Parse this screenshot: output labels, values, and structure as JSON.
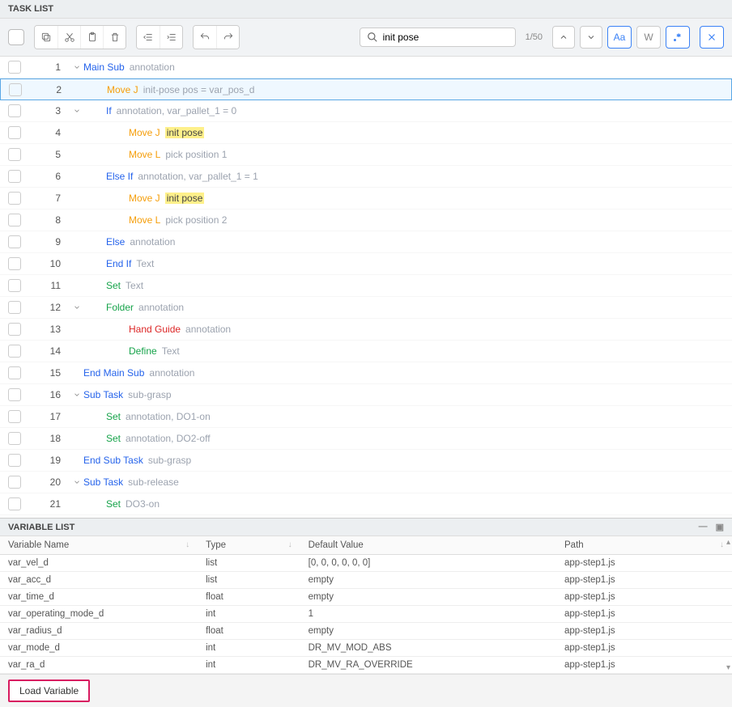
{
  "task_list": {
    "title": "TASK LIST",
    "search_value": "init pose",
    "count": "1/50",
    "toggles": {
      "aa": "Aa",
      "w": "W"
    }
  },
  "rows": [
    {
      "n": "1",
      "chev": true,
      "indent": 0,
      "parts": [
        [
          "blue",
          "Main Sub"
        ],
        [
          "anno",
          "annotation"
        ]
      ]
    },
    {
      "n": "2",
      "chev": false,
      "indent": 2,
      "selected": true,
      "parts": [
        [
          "orange",
          "Move J"
        ],
        [
          "anno",
          "init-pose  pos = var_pos_d"
        ]
      ]
    },
    {
      "n": "3",
      "chev": true,
      "indent": 2,
      "parts": [
        [
          "blue",
          "If"
        ],
        [
          "anno",
          "annotation,  var_pallet_1 = 0"
        ]
      ]
    },
    {
      "n": "4",
      "chev": false,
      "indent": 4,
      "parts": [
        [
          "orange",
          "Move J"
        ],
        [
          "hl",
          "init pose"
        ]
      ]
    },
    {
      "n": "5",
      "chev": false,
      "indent": 4,
      "parts": [
        [
          "orange",
          "Move L"
        ],
        [
          "anno",
          "pick position 1"
        ]
      ]
    },
    {
      "n": "6",
      "chev": false,
      "indent": 2,
      "parts": [
        [
          "blue",
          "Else If"
        ],
        [
          "anno",
          "annotation,  var_pallet_1 = 1"
        ]
      ]
    },
    {
      "n": "7",
      "chev": false,
      "indent": 4,
      "parts": [
        [
          "orange",
          "Move J"
        ],
        [
          "hl",
          "init pose"
        ]
      ]
    },
    {
      "n": "8",
      "chev": false,
      "indent": 4,
      "parts": [
        [
          "orange",
          "Move L"
        ],
        [
          "anno",
          "pick position 2"
        ]
      ]
    },
    {
      "n": "9",
      "chev": false,
      "indent": 2,
      "parts": [
        [
          "blue",
          "Else"
        ],
        [
          "anno",
          "annotation"
        ]
      ]
    },
    {
      "n": "10",
      "chev": false,
      "indent": 2,
      "parts": [
        [
          "blue",
          "End If"
        ],
        [
          "anno",
          "Text"
        ]
      ]
    },
    {
      "n": "11",
      "chev": false,
      "indent": 2,
      "parts": [
        [
          "green",
          "Set"
        ],
        [
          "anno",
          "Text"
        ]
      ]
    },
    {
      "n": "12",
      "chev": true,
      "indent": 2,
      "parts": [
        [
          "green",
          "Folder"
        ],
        [
          "anno",
          "annotation"
        ]
      ]
    },
    {
      "n": "13",
      "chev": false,
      "indent": 4,
      "parts": [
        [
          "red",
          "Hand Guide"
        ],
        [
          "anno",
          "annotation"
        ]
      ]
    },
    {
      "n": "14",
      "chev": false,
      "indent": 4,
      "parts": [
        [
          "green",
          "Define"
        ],
        [
          "anno",
          "Text"
        ]
      ]
    },
    {
      "n": "15",
      "chev": false,
      "indent": 0,
      "parts": [
        [
          "blue",
          "End Main Sub"
        ],
        [
          "anno",
          "annotation"
        ]
      ]
    },
    {
      "n": "16",
      "chev": true,
      "indent": 0,
      "parts": [
        [
          "blue",
          "Sub Task"
        ],
        [
          "anno",
          "sub-grasp"
        ]
      ]
    },
    {
      "n": "17",
      "chev": false,
      "indent": 2,
      "parts": [
        [
          "green",
          "Set"
        ],
        [
          "anno",
          "annotation,  DO1-on"
        ]
      ]
    },
    {
      "n": "18",
      "chev": false,
      "indent": 2,
      "parts": [
        [
          "green",
          "Set"
        ],
        [
          "anno",
          "annotation,  DO2-off"
        ]
      ]
    },
    {
      "n": "19",
      "chev": false,
      "indent": 0,
      "parts": [
        [
          "blue",
          "End Sub Task"
        ],
        [
          "anno",
          "sub-grasp"
        ]
      ]
    },
    {
      "n": "20",
      "chev": true,
      "indent": 0,
      "parts": [
        [
          "blue",
          "Sub Task"
        ],
        [
          "anno",
          "sub-release"
        ]
      ]
    },
    {
      "n": "21",
      "chev": false,
      "indent": 2,
      "parts": [
        [
          "green",
          "Set"
        ],
        [
          "anno",
          "DO3-on"
        ]
      ]
    }
  ],
  "variable_list": {
    "title": "VARIABLE LIST",
    "col_name": "Variable Name",
    "col_type": "Type",
    "col_default": "Default Value",
    "col_path": "Path",
    "rows": [
      {
        "name": "var_vel_d",
        "type": "list",
        "def": "[0, 0, 0, 0, 0, 0]",
        "path": "app-step1.js"
      },
      {
        "name": "var_acc_d",
        "type": "list",
        "def": "empty",
        "path": "app-step1.js"
      },
      {
        "name": "var_time_d",
        "type": "float",
        "def": "empty",
        "path": "app-step1.js"
      },
      {
        "name": "var_operating_mode_d",
        "type": "int",
        "def": "1",
        "path": "app-step1.js"
      },
      {
        "name": "var_radius_d",
        "type": "float",
        "def": "empty",
        "path": "app-step1.js"
      },
      {
        "name": "var_mode_d",
        "type": "int",
        "def": "DR_MV_MOD_ABS",
        "path": "app-step1.js"
      },
      {
        "name": "var_ra_d",
        "type": "int",
        "def": "DR_MV_RA_OVERRIDE",
        "path": "app-step1.js"
      }
    ]
  },
  "load_btn": "Load Variable"
}
